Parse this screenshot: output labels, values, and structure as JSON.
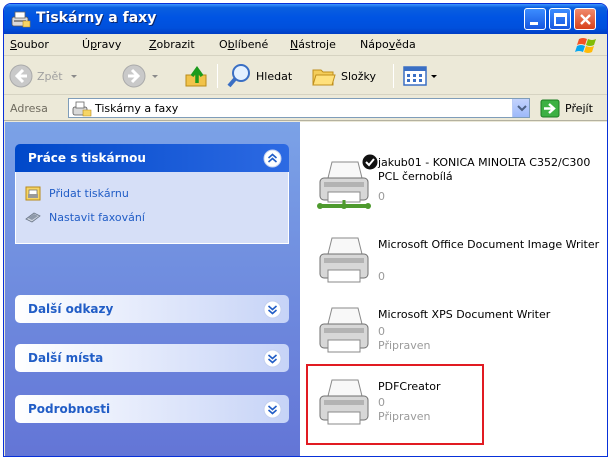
{
  "window": {
    "title": "Tiskárny a faxy"
  },
  "menu": [
    {
      "pre": "",
      "u": "S",
      "post": "oubor"
    },
    {
      "pre": "Ú",
      "u": "p",
      "post": "ravy"
    },
    {
      "pre": "",
      "u": "Z",
      "post": "obrazit"
    },
    {
      "pre": "O",
      "u": "b",
      "post": "líbené"
    },
    {
      "pre": "",
      "u": "N",
      "post": "ástroje"
    },
    {
      "pre": "Nápo",
      "u": "v",
      "post": "ěda"
    }
  ],
  "toolbar": {
    "back_label": "Zpět",
    "search_label": "Hledat",
    "folders_label": "Složky"
  },
  "address": {
    "label": "Adresa",
    "value": "Tiskárny a faxy",
    "go_label": "Přejít"
  },
  "taskpane": {
    "printer_tasks": {
      "title": "Práce s tiskárnou",
      "items": [
        {
          "label": "Přidat tiskárnu",
          "icon": "add-printer-icon"
        },
        {
          "label": "Nastavit faxování",
          "icon": "fax-setup-icon"
        }
      ]
    },
    "other_links": {
      "title": "Další odkazy"
    },
    "other_places": {
      "title": "Další místa"
    },
    "details": {
      "title": "Podrobnosti"
    }
  },
  "printers": [
    {
      "name": "jakub01 - KONICA MINOLTA C352/C300 PCL černobílá",
      "count": "0",
      "status": "",
      "default": true,
      "shared": true
    },
    {
      "name": "Microsoft Office Document Image Writer",
      "count": "0",
      "status": "",
      "default": false,
      "shared": false
    },
    {
      "name": "Microsoft XPS Document Writer",
      "count": "0",
      "status": "Připraven",
      "default": false,
      "shared": false
    },
    {
      "name": "PDFCreator",
      "count": "0",
      "status": "Připraven",
      "default": false,
      "shared": false
    }
  ],
  "colors": {
    "titlebar": "#0054e3",
    "taskpane_link": "#215dc6",
    "highlight": "#e11b22"
  }
}
